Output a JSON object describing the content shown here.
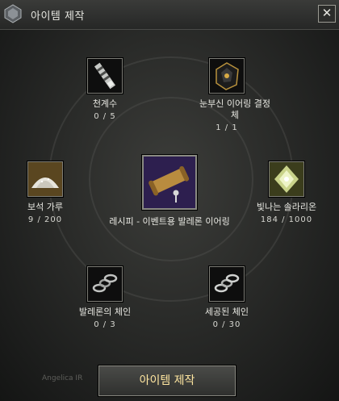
{
  "window": {
    "title": "아이템 제작",
    "close_label": "✕"
  },
  "materials": [
    {
      "name": "천계수",
      "count": "0 / 5",
      "icon": "bottle-icon"
    },
    {
      "name": "눈부신 이어링 결정체",
      "count": "1 / 1",
      "icon": "black-crystal-icon"
    },
    {
      "name": "보석 가루",
      "count": "9 / 200",
      "icon": "gem-powder-icon"
    },
    {
      "name": "빛나는 솔라리온",
      "count": "184 / 1000",
      "icon": "shining-crystal-icon"
    },
    {
      "name": "발레론의 체인",
      "count": "0 / 3",
      "icon": "chain-icon"
    },
    {
      "name": "세공된 체인",
      "count": "0 / 30",
      "icon": "chain-icon"
    }
  ],
  "recipe": {
    "name": "레시피 - 이벤트용 발레론 이어링",
    "icon": "recipe-scroll-icon"
  },
  "craft_button": {
    "label": "아이템 제작"
  },
  "background_text": "Angelica IR",
  "colors": {
    "accent": "#ffe6a0",
    "recipe_bg": "#2a1f45"
  }
}
